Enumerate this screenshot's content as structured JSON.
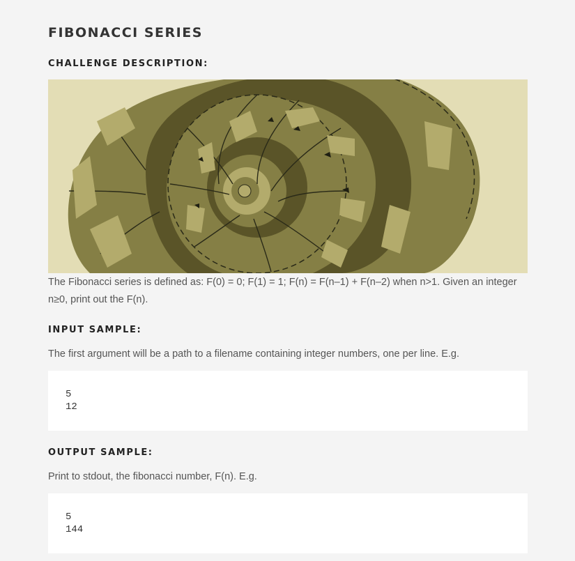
{
  "title": "FIBONACCI SERIES",
  "challenge": {
    "heading": "CHALLENGE DESCRIPTION:",
    "image": "nautilus-shell-illustration",
    "text": "The Fibonacci series is defined as: F(0) = 0; F(1) = 1; F(n) = F(n–1) + F(n–2) when n>1. Given an integer n≥0, print out the F(n)."
  },
  "input_sample": {
    "heading": "INPUT SAMPLE:",
    "text": "The first argument will be a path to a filename containing integer numbers, one per line. E.g.",
    "code_lines": [
      "5",
      "12"
    ]
  },
  "output_sample": {
    "heading": "OUTPUT SAMPLE:",
    "text": "Print to stdout, the fibonacci number, F(n). E.g.",
    "code_lines": [
      "5",
      "144"
    ]
  },
  "colors": {
    "background": "#f4f4f4",
    "banner_bg": "#e3ddb5",
    "shell_dark": "#5a5428",
    "shell_mid": "#857f45",
    "shell_light": "#b3ab6c"
  }
}
